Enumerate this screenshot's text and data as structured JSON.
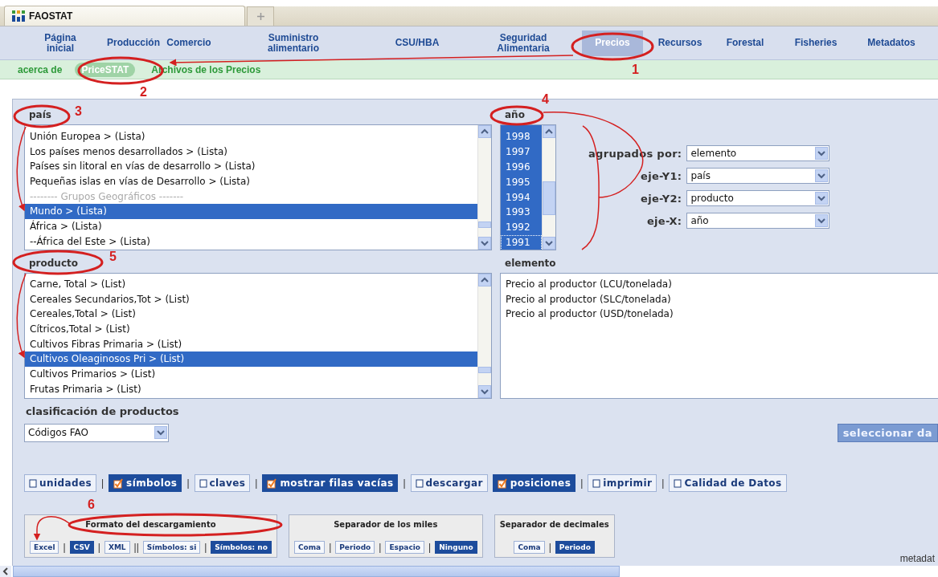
{
  "browser_tab": {
    "title": "FAOSTAT"
  },
  "nav": [
    {
      "label": "Página inicial",
      "selected": false
    },
    {
      "label": "Producción",
      "selected": false
    },
    {
      "label": "Comercio",
      "selected": false
    },
    {
      "label": "Suministro alimentario",
      "selected": false
    },
    {
      "label": "CSU/HBA",
      "selected": false
    },
    {
      "label": "Seguridad Alimentaria",
      "selected": false
    },
    {
      "label": "Precios",
      "selected": true
    },
    {
      "label": "Recursos",
      "selected": false
    },
    {
      "label": "Forestal",
      "selected": false
    },
    {
      "label": "Fisheries",
      "selected": false
    },
    {
      "label": "Metadatos",
      "selected": false
    }
  ],
  "subnav": [
    {
      "label": "acerca de",
      "selected": false
    },
    {
      "label": "PriceSTAT",
      "selected": true
    },
    {
      "label": "Archivos de los Precios",
      "selected": false
    }
  ],
  "pais": {
    "label": "país",
    "items": [
      {
        "label": "Unión Europea > (Lista)",
        "kind": "item",
        "selected": false
      },
      {
        "label": "Los países menos desarrollados > (Lista)",
        "kind": "item",
        "selected": false
      },
      {
        "label": "Países sin litoral en vías de desarrollo > (Lista)",
        "kind": "item",
        "selected": false
      },
      {
        "label": "Pequeñas islas en vías de Desarrollo > (Lista)",
        "kind": "item",
        "selected": false
      },
      {
        "label": "-------- Grupos Geográficos -------",
        "kind": "separator",
        "selected": false
      },
      {
        "label": "Mundo > (Lista)",
        "kind": "item",
        "selected": true
      },
      {
        "label": "África > (Lista)",
        "kind": "item",
        "selected": false
      },
      {
        "label": "--África del Este > (Lista)",
        "kind": "item",
        "selected": false
      }
    ]
  },
  "anio": {
    "label": "año",
    "items": [
      {
        "label": "1998",
        "selected": true
      },
      {
        "label": "1997",
        "selected": true
      },
      {
        "label": "1996",
        "selected": true
      },
      {
        "label": "1995",
        "selected": true
      },
      {
        "label": "1994",
        "selected": true
      },
      {
        "label": "1993",
        "selected": true
      },
      {
        "label": "1992",
        "selected": true
      },
      {
        "label": "1991",
        "selected": true
      }
    ]
  },
  "axes": [
    {
      "label": "agrupados por:",
      "value": "elemento"
    },
    {
      "label": "eje-Y1:",
      "value": "país"
    },
    {
      "label": "eje-Y2:",
      "value": "producto"
    },
    {
      "label": "eje-X:",
      "value": "año"
    }
  ],
  "producto": {
    "label": "producto",
    "items": [
      {
        "label": "Carne, Total > (List)",
        "kind": "item",
        "selected": false
      },
      {
        "label": "Cereales Secundarios,Tot > (List)",
        "kind": "item",
        "selected": false
      },
      {
        "label": "Cereales,Total > (List)",
        "kind": "item",
        "selected": false
      },
      {
        "label": "Cítricos,Total > (List)",
        "kind": "item",
        "selected": false
      },
      {
        "label": "Cultivos Fibras Primaria > (List)",
        "kind": "item",
        "selected": false
      },
      {
        "label": "Cultivos Oleaginosos Pri > (List)",
        "kind": "item",
        "selected": true
      },
      {
        "label": "Cultivos Primarios > (List)",
        "kind": "item",
        "selected": false
      },
      {
        "label": "Frutas Primaria > (List)",
        "kind": "item",
        "selected": false
      }
    ]
  },
  "elemento": {
    "label": "elemento",
    "items": [
      {
        "label": "Precio al productor (LCU/tonelada)",
        "selected": false
      },
      {
        "label": "Precio al productor (SLC/tonelada)",
        "selected": false
      },
      {
        "label": "Precio al productor (USD/tonelada)",
        "selected": false
      }
    ]
  },
  "clasificacion": {
    "label": "clasificación de productos",
    "value": "Códigos FAO"
  },
  "select_button": {
    "label": "seleccionar da"
  },
  "options": [
    {
      "kind": "option",
      "label": "unidades",
      "checked": false
    },
    {
      "kind": "separator",
      "label": "|"
    },
    {
      "kind": "option",
      "label": "símbolos",
      "checked": true
    },
    {
      "kind": "separator",
      "label": "|"
    },
    {
      "kind": "option",
      "label": "claves",
      "checked": false
    },
    {
      "kind": "separator",
      "label": "|"
    },
    {
      "kind": "option",
      "label": "mostrar filas vacías",
      "checked": true
    },
    {
      "kind": "separator",
      "label": "|"
    },
    {
      "kind": "option",
      "label": "descargar",
      "checked": false
    },
    {
      "kind": "option",
      "label": "posiciones",
      "checked": true
    },
    {
      "kind": "separator",
      "label": "|"
    },
    {
      "kind": "option",
      "label": "imprimir",
      "checked": false
    },
    {
      "kind": "separator",
      "label": "|"
    },
    {
      "kind": "option",
      "label": "Calidad de Datos",
      "checked": false
    }
  ],
  "download_groups": [
    {
      "title": "Formato del descargamiento",
      "buttons": [
        {
          "kind": "button",
          "label": "Excel",
          "selected": false
        },
        {
          "kind": "separator",
          "label": "|"
        },
        {
          "kind": "button",
          "label": "CSV",
          "selected": true
        },
        {
          "kind": "separator",
          "label": "|"
        },
        {
          "kind": "button",
          "label": "XML",
          "selected": false
        },
        {
          "kind": "separator",
          "label": "||"
        },
        {
          "kind": "button",
          "label": "Símbolos: si",
          "selected": false
        },
        {
          "kind": "separator",
          "label": "|"
        },
        {
          "kind": "button",
          "label": "Símbolos: no",
          "selected": true
        }
      ]
    },
    {
      "title": "Separador de los miles",
      "buttons": [
        {
          "kind": "button",
          "label": "Coma",
          "selected": false
        },
        {
          "kind": "separator",
          "label": "|"
        },
        {
          "kind": "button",
          "label": "Periodo",
          "selected": false
        },
        {
          "kind": "separator",
          "label": "|"
        },
        {
          "kind": "button",
          "label": "Espacio",
          "selected": false
        },
        {
          "kind": "separator",
          "label": "|"
        },
        {
          "kind": "button",
          "label": "Ninguno",
          "selected": true
        }
      ]
    },
    {
      "title": "Separador de decimales",
      "buttons": [
        {
          "kind": "button",
          "label": "Coma",
          "selected": false
        },
        {
          "kind": "separator",
          "label": "|"
        },
        {
          "kind": "button",
          "label": "Periodo",
          "selected": true
        }
      ]
    }
  ],
  "metadata_link": {
    "label": "metadat"
  },
  "annotations": [
    "1",
    "2",
    "3",
    "4",
    "5",
    "6"
  ]
}
